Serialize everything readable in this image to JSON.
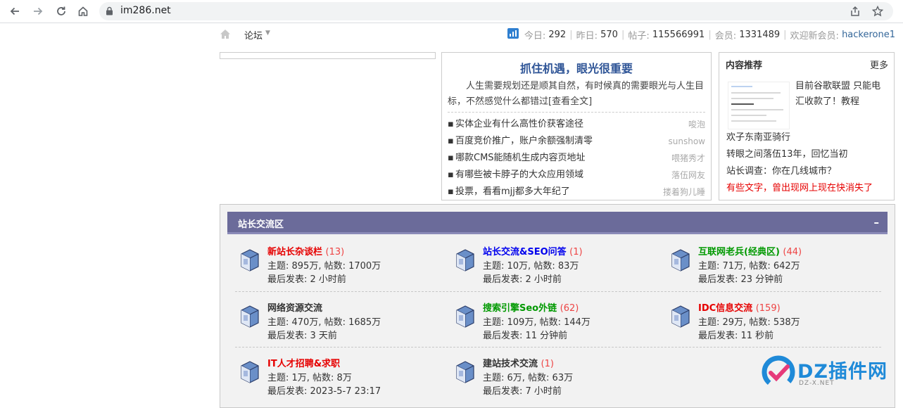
{
  "browser": {
    "url": "im286.net",
    "icons": [
      "back-icon",
      "forward-icon",
      "reload-icon",
      "home-icon",
      "lock-icon",
      "share-icon",
      "star-icon"
    ]
  },
  "infobar": {
    "forum_label": "论坛",
    "stats": {
      "today_label": "今日:",
      "today": "292",
      "yesterday_label": "昨日:",
      "yesterday": "570",
      "posts_label": "帖子:",
      "posts": "115566991",
      "members_label": "会员:",
      "members": "1331489",
      "welcome_label": "欢迎新会员:",
      "new_member": "hackerone1"
    }
  },
  "news": {
    "title": "抓住机遇，眼光很重要",
    "desc": "人生需要规划还是顺其自然，有时候真的需要眼光与人生目标，不然感觉什么都错过[查看全文]",
    "items": [
      {
        "title": "实体企业有什么高性价获客途径",
        "author": "唆泡"
      },
      {
        "title": "百度竞价推广，账户余额强制清零",
        "author": "sunshow"
      },
      {
        "title": "哪款CMS能随机生成内容页地址",
        "author": "喂猪秀才"
      },
      {
        "title": "有哪些被卡脖子的大众应用领域",
        "author": "落伍网友"
      },
      {
        "title": "投票，看看mjj都多大年纪了",
        "author": "搂着狗儿睡"
      }
    ]
  },
  "recommend": {
    "header": "内容推荐",
    "more": "更多",
    "feature": "目前谷歌联盟 只能电汇收款了！教程",
    "items": [
      {
        "text": "欢子东南亚骑行",
        "red": false
      },
      {
        "text": "转眼之间落伍13年，回忆当初",
        "red": false
      },
      {
        "text": "站长调查：你在几线城市？",
        "red": false
      },
      {
        "text": "有些文字，曾出现网上现在快消失了",
        "red": true
      }
    ]
  },
  "category": {
    "title": "站长交流区",
    "collapse": "–",
    "forums": [
      {
        "name": "新站长杂谈栏",
        "count": "(13)",
        "color": "#e60000",
        "stat": "主题: 895万, 帖数: 1700万",
        "last": "最后发表: 2 小时前"
      },
      {
        "name": "站长交流&SEO问答",
        "count": "(1)",
        "color": "#0000ee",
        "stat": "主题: 10万, 帖数: 83万",
        "last": "最后发表: 2 小时前"
      },
      {
        "name": "互联网老兵(经典区)",
        "count": "(44)",
        "color": "#009900",
        "stat": "主题: 71万, 帖数: 642万",
        "last": "最后发表: 23 分钟前"
      },
      {
        "name": "网络资源交流",
        "count": "",
        "color": "#333333",
        "stat": "主题: 470万, 帖数: 1685万",
        "last": "最后发表: 3 天前"
      },
      {
        "name": "搜索引擎Seo外链",
        "count": "(62)",
        "color": "#009900",
        "stat": "主题: 109万, 帖数: 144万",
        "last": "最后发表: 11 分钟前"
      },
      {
        "name": "IDC信息交流",
        "count": "(159)",
        "color": "#e60000",
        "stat": "主题: 29万, 帖数: 538万",
        "last": "最后发表: 11 秒前"
      },
      {
        "name": "IT人才招聘&求职",
        "count": "",
        "color": "#e60000",
        "stat": "主题: 1万, 帖数: 8万",
        "last": "最后发表: 2023-5-7 23:17"
      },
      {
        "name": "建站技术交流",
        "count": "(1)",
        "color": "#333333",
        "stat": "主题: 6万, 帖数: 63万",
        "last": "最后发表: 7 小时前"
      }
    ]
  },
  "watermark": {
    "text": "DZ插件网",
    "sub": "DZ-X.NET"
  }
}
